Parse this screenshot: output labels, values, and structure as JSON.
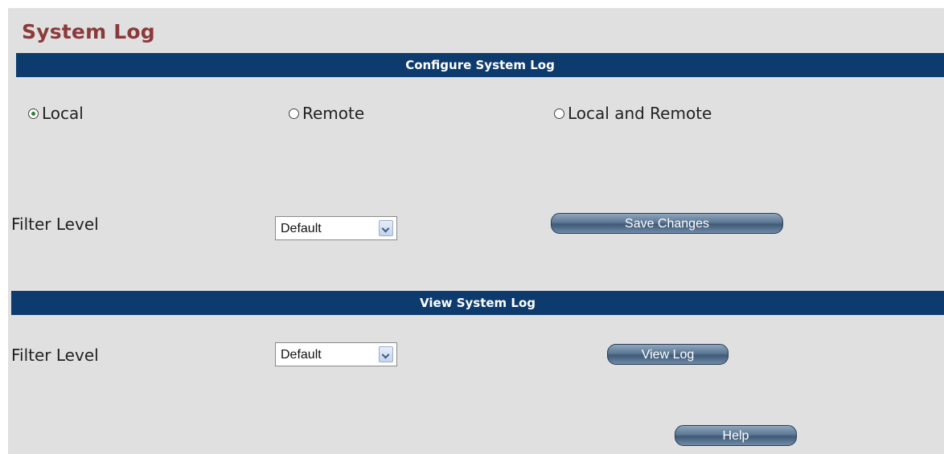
{
  "page": {
    "title": "System Log"
  },
  "configure": {
    "header": "Configure System Log",
    "radios": [
      {
        "label": "Local",
        "checked": true
      },
      {
        "label": "Remote",
        "checked": false
      },
      {
        "label": "Local and Remote",
        "checked": false
      }
    ],
    "filter_label": "Filter Level",
    "filter_value": "Default",
    "save_label": "Save Changes"
  },
  "view": {
    "header": "View System Log",
    "filter_label": "Filter Level",
    "filter_value": "Default",
    "view_label": "View Log"
  },
  "help_label": "Help",
  "colors": {
    "title": "#8b3a3a",
    "header_bar": "#0d3b6e",
    "background": "#e0e0e0"
  }
}
